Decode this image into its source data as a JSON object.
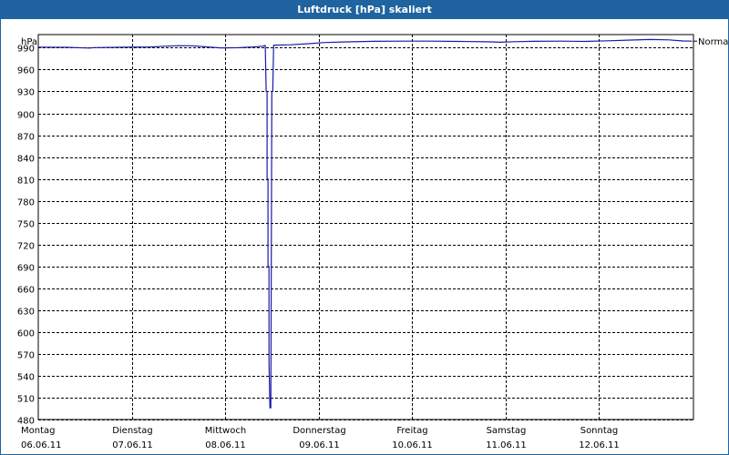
{
  "chart_data": {
    "type": "line",
    "title": "Luftdruck [hPa] skaliert",
    "ylabel": "hPa",
    "ylim": [
      480,
      1008
    ],
    "yticks": [
      990,
      960,
      930,
      900,
      870,
      840,
      810,
      780,
      750,
      720,
      690,
      660,
      630,
      600,
      570,
      540,
      510,
      480
    ],
    "xlim": [
      0,
      7
    ],
    "xticks": [
      {
        "x": 0,
        "day": "Montag",
        "date": "06.06.11"
      },
      {
        "x": 1,
        "day": "Dienstag",
        "date": "07.06.11"
      },
      {
        "x": 2,
        "day": "Mittwoch",
        "date": "08.06.11"
      },
      {
        "x": 3,
        "day": "Donnerstag",
        "date": "09.06.11"
      },
      {
        "x": 4,
        "day": "Freitag",
        "date": "10.06.11"
      },
      {
        "x": 5,
        "day": "Samstag",
        "date": "11.06.11"
      },
      {
        "x": 6,
        "day": "Sonntag",
        "date": "12.06.11"
      }
    ],
    "grid": true,
    "series": [
      {
        "name": "Normal",
        "color": "#1a1aa6",
        "points": [
          [
            0.0,
            990.8
          ],
          [
            0.3,
            990.5
          ],
          [
            0.55,
            989.5
          ],
          [
            0.6,
            990.2
          ],
          [
            0.9,
            990.6
          ],
          [
            1.2,
            991.0
          ],
          [
            1.35,
            992.0
          ],
          [
            1.5,
            992.8
          ],
          [
            1.65,
            992.6
          ],
          [
            1.8,
            991.2
          ],
          [
            1.95,
            989.8
          ],
          [
            2.15,
            990.0
          ],
          [
            2.3,
            991.0
          ],
          [
            2.4,
            992.0
          ],
          [
            2.43,
            993.0
          ],
          [
            2.44,
            930.0
          ],
          [
            2.45,
            930.0
          ],
          [
            2.45,
            810.0
          ],
          [
            2.46,
            810.0
          ],
          [
            2.46,
            690.0
          ],
          [
            2.47,
            690.0
          ],
          [
            2.47,
            560.0
          ],
          [
            2.48,
            496.0
          ],
          [
            2.49,
            496.0
          ],
          [
            2.5,
            930.0
          ],
          [
            2.51,
            930.0
          ],
          [
            2.52,
            993.5
          ],
          [
            2.7,
            994.0
          ],
          [
            2.9,
            995.5
          ],
          [
            3.05,
            997.0
          ],
          [
            3.3,
            998.0
          ],
          [
            3.6,
            998.8
          ],
          [
            3.9,
            999.0
          ],
          [
            4.2,
            999.0
          ],
          [
            4.5,
            998.7
          ],
          [
            4.8,
            998.2
          ],
          [
            4.95,
            997.5
          ],
          [
            5.1,
            998.3
          ],
          [
            5.3,
            998.8
          ],
          [
            5.6,
            999.0
          ],
          [
            5.85,
            998.6
          ],
          [
            6.1,
            999.5
          ],
          [
            6.35,
            1000.5
          ],
          [
            6.55,
            1001.2
          ],
          [
            6.75,
            1000.8
          ],
          [
            6.9,
            999.2
          ],
          [
            7.0,
            999.0
          ]
        ]
      }
    ]
  }
}
